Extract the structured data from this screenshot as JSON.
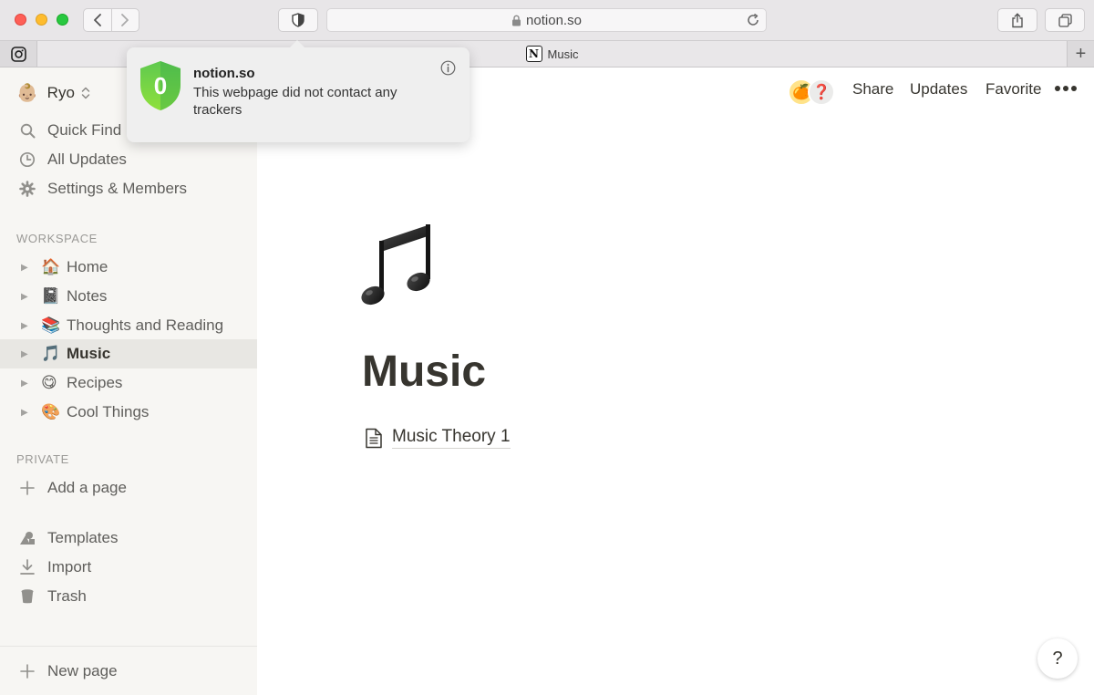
{
  "browser": {
    "url": "notion.so",
    "tab_title": "Music",
    "tab_favicon_letter": "N"
  },
  "tracker_popover": {
    "shield_count": "0",
    "host": "notion.so",
    "message": "This webpage did not contact any trackers"
  },
  "sidebar": {
    "user_avatar": "👶🏼",
    "user_name": "Ryo",
    "top_items": [
      {
        "label": "Quick Find",
        "icon": "search-icon"
      },
      {
        "label": "All Updates",
        "icon": "clock-icon"
      },
      {
        "label": "Settings & Members",
        "icon": "gear-icon"
      }
    ],
    "workspace_label": "WORKSPACE",
    "workspace_pages": [
      {
        "emoji": "🏠",
        "label": "Home"
      },
      {
        "emoji": "📓",
        "label": "Notes"
      },
      {
        "emoji": "📚",
        "label": "Thoughts and Reading"
      },
      {
        "emoji": "🎵",
        "label": "Music",
        "active": true
      },
      {
        "emoji": "😋",
        "label": "Recipes"
      },
      {
        "emoji": "🎨",
        "label": "Cool Things"
      }
    ],
    "private_label": "PRIVATE",
    "add_page_label": "Add a page",
    "bottom_items": [
      {
        "label": "Templates",
        "icon": "templates-icon"
      },
      {
        "label": "Import",
        "icon": "import-icon"
      },
      {
        "label": "Trash",
        "icon": "trash-icon"
      }
    ],
    "new_page_label": "New page"
  },
  "topbar": {
    "avatar_1": "🍊",
    "avatar_2": "❓",
    "share_label": "Share",
    "updates_label": "Updates",
    "favorite_label": "Favorite"
  },
  "page": {
    "icon": "music-notes-icon",
    "title": "Music",
    "subpages": [
      {
        "label": "Music Theory 1"
      }
    ]
  },
  "help_label": "?"
}
